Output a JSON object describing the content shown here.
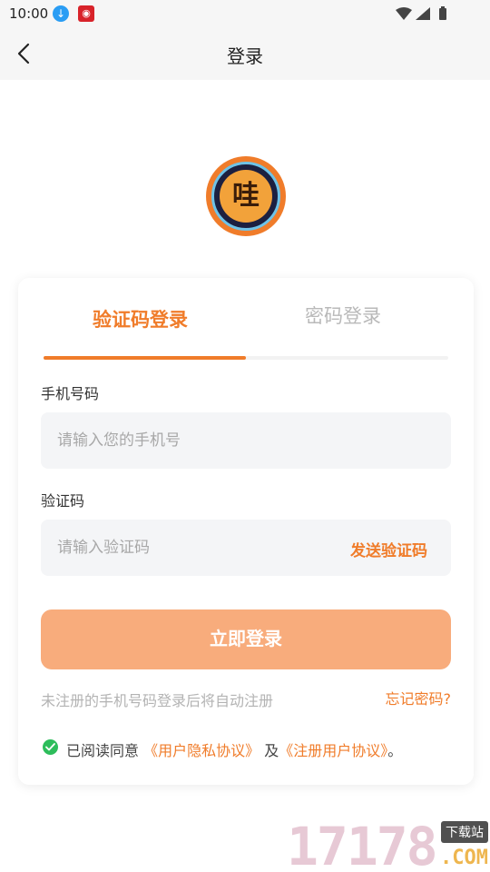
{
  "status_bar": {
    "time": "10:00"
  },
  "nav": {
    "title": "登录"
  },
  "logo": {
    "char": "哇"
  },
  "tabs": {
    "sms": "验证码登录",
    "password": "密码登录"
  },
  "form": {
    "phone_label": "手机号码",
    "phone_placeholder": "请输入您的手机号",
    "code_label": "验证码",
    "code_placeholder": "请输入验证码",
    "send_code": "发送验证码",
    "login_button": "立即登录",
    "auto_register_note": "未注册的手机号码登录后将自动注册",
    "forgot_password": "忘记密码?"
  },
  "agreement": {
    "prefix": "已阅读同意",
    "privacy": "《用户隐私协议》",
    "and": "及",
    "register": "《注册用户协议》",
    "suffix": "。"
  },
  "watermark": {
    "number": "17178",
    "tag": "下载站",
    "domain": ".COM"
  },
  "colors": {
    "accent": "#f07c2a",
    "button": "#f8ac7c",
    "check": "#2dbd5b"
  }
}
